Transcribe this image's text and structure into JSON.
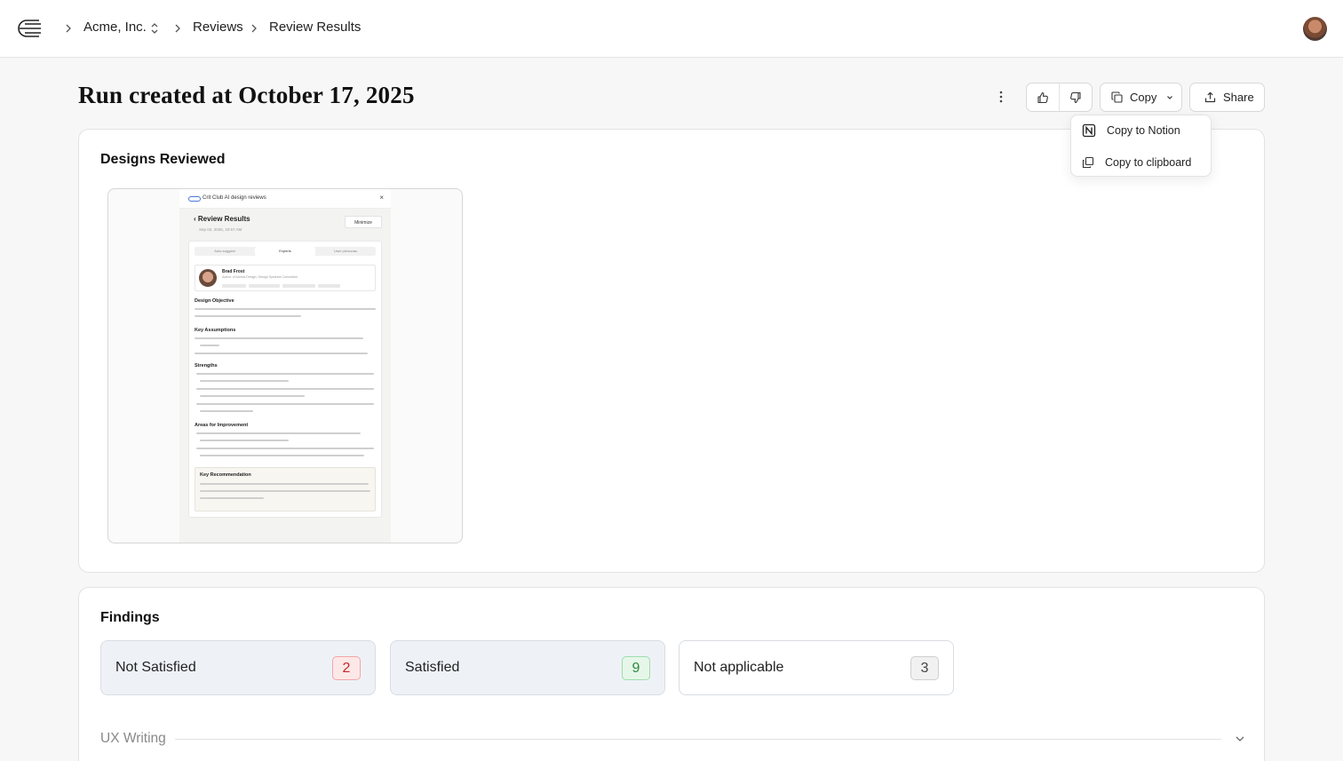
{
  "nav": {
    "org": "Acme, Inc.",
    "crumb_reviews": "Reviews",
    "crumb_current": "Review Results"
  },
  "header": {
    "title": "Run created at October 17, 2025",
    "copy_label": "Copy",
    "share_label": "Share"
  },
  "copy_menu": {
    "items": [
      {
        "label": "Copy to Notion",
        "icon": "notion-icon"
      },
      {
        "label": "Copy to clipboard",
        "icon": "clipboard-icon"
      }
    ]
  },
  "designs": {
    "title": "Designs Reviewed",
    "thumbnail": {
      "app_name": "Crit Club AI design reviews",
      "title": "Review Results",
      "date": "Sep 02, 2025, 10:57 AM",
      "minimize": "Minimize",
      "tabs": [
        "Auto-suggest",
        "Experts",
        "User personas"
      ],
      "expert_name": "Brad Frost",
      "expert_sub": "Author of Atomic Design, Design Systems Consultant",
      "sections": [
        "Design Objective",
        "Key Assumptions",
        "Strengths",
        "Areas for Improvement"
      ],
      "rec_title": "Key Recommendation"
    }
  },
  "findings": {
    "title": "Findings",
    "stats": [
      {
        "label": "Not Satisfied",
        "count": "2"
      },
      {
        "label": "Satisfied",
        "count": "9"
      },
      {
        "label": "Not applicable",
        "count": "3"
      }
    ],
    "section": "UX Writing"
  },
  "colors": {
    "danger_bg": "#fde8e8",
    "danger_border": "#f3a5a5",
    "danger_text": "#c62828",
    "success_bg": "#e6f7ea",
    "success_border": "#9fdcab",
    "success_text": "#2e8b3d",
    "neutral_bg": "#f1f1f1",
    "neutral_border": "#cfcfcf"
  }
}
